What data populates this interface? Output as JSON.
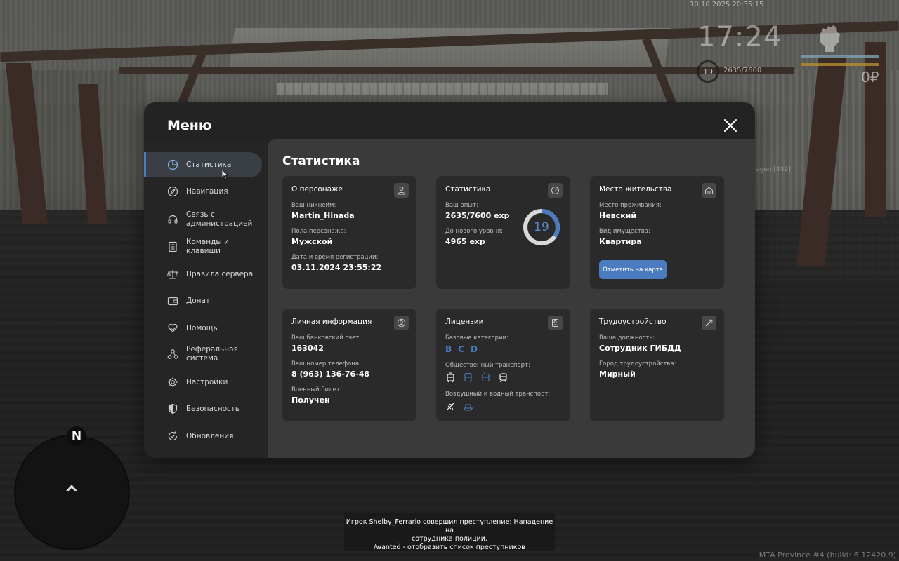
{
  "hud": {
    "datetime": "10.10.2025 20:35:15",
    "time": "17:24",
    "money": "0₽",
    "level": "19",
    "exp": "2635/7600",
    "nick_tag": "agen [439]"
  },
  "menu": {
    "title": "Меню",
    "nav": [
      {
        "label": "Статистика",
        "icon": "pie-chart-icon",
        "active": true
      },
      {
        "label": "Навигация",
        "icon": "compass-icon"
      },
      {
        "label": "Связь с администрацией",
        "icon": "headset-icon"
      },
      {
        "label": "Команды и клавиши",
        "icon": "document-icon"
      },
      {
        "label": "Правила сервера",
        "icon": "scales-icon"
      },
      {
        "label": "Донат",
        "icon": "wallet-icon"
      },
      {
        "label": "Помощь",
        "icon": "heart-hands-icon"
      },
      {
        "label": "Реферальная система",
        "icon": "referral-icon"
      },
      {
        "label": "Настройки",
        "icon": "gear-icon"
      },
      {
        "label": "Безопасность",
        "icon": "shield-icon"
      },
      {
        "label": "Обновления",
        "icon": "refresh-icon"
      }
    ]
  },
  "content": {
    "title": "Статистика",
    "character": {
      "title": "О персонаже",
      "nick_label": "Ваш никнейм:",
      "nick": "Martin_Hinada",
      "gender_label": "Пола персонажа:",
      "gender": "Мужской",
      "reg_label": "Дата и время регистрации:",
      "reg": "03.11.2024 23:55:22"
    },
    "stats": {
      "title": "Статистика",
      "exp_label": "Ваш опыт:",
      "exp": "2635/7600 exp",
      "next_label": "До нового уровня:",
      "next": "4965 exp",
      "level": "19",
      "progress": 0.3467
    },
    "residence": {
      "title": "Место жительства",
      "place_label": "Место проживания:",
      "place": "Невский",
      "type_label": "Вид имущества:",
      "type": "Квартира",
      "button": "Отметить на карте"
    },
    "personal": {
      "title": "Личная информация",
      "bank_label": "Ваш банковский счет:",
      "bank": "163042",
      "phone_label": "Ваш номер телефона:",
      "phone": "8 (963) 136-76-48",
      "military_label": "Военный билет:",
      "military": "Получен"
    },
    "licenses": {
      "title": "Лицензии",
      "base_label": "Базовые категории:",
      "categories": [
        "B",
        "C",
        "D"
      ],
      "public_label": "Общественный транспорт:",
      "air_label": "Воздушный и водный транспорт:"
    },
    "employment": {
      "title": "Трудоустройство",
      "position_label": "Ваша должность:",
      "position": "Сотрудник ГИБДД",
      "city_label": "Город трудоустройства:",
      "city": "Мирный"
    }
  },
  "minimap": {
    "north": "N"
  },
  "notice": {
    "line1": "Игрок Shelby_Ferrario совершил преступление: Нападение на",
    "line2": "сотрудника полиции.",
    "line3": "/wanted - отобразить список преступников"
  },
  "build": "MTA Province #4 (build: 6.12420.9)",
  "colors": {
    "accent": "#4c7cc0",
    "panel": "#232323",
    "card": "#2a2a2a",
    "content": "#3a3a3a"
  }
}
